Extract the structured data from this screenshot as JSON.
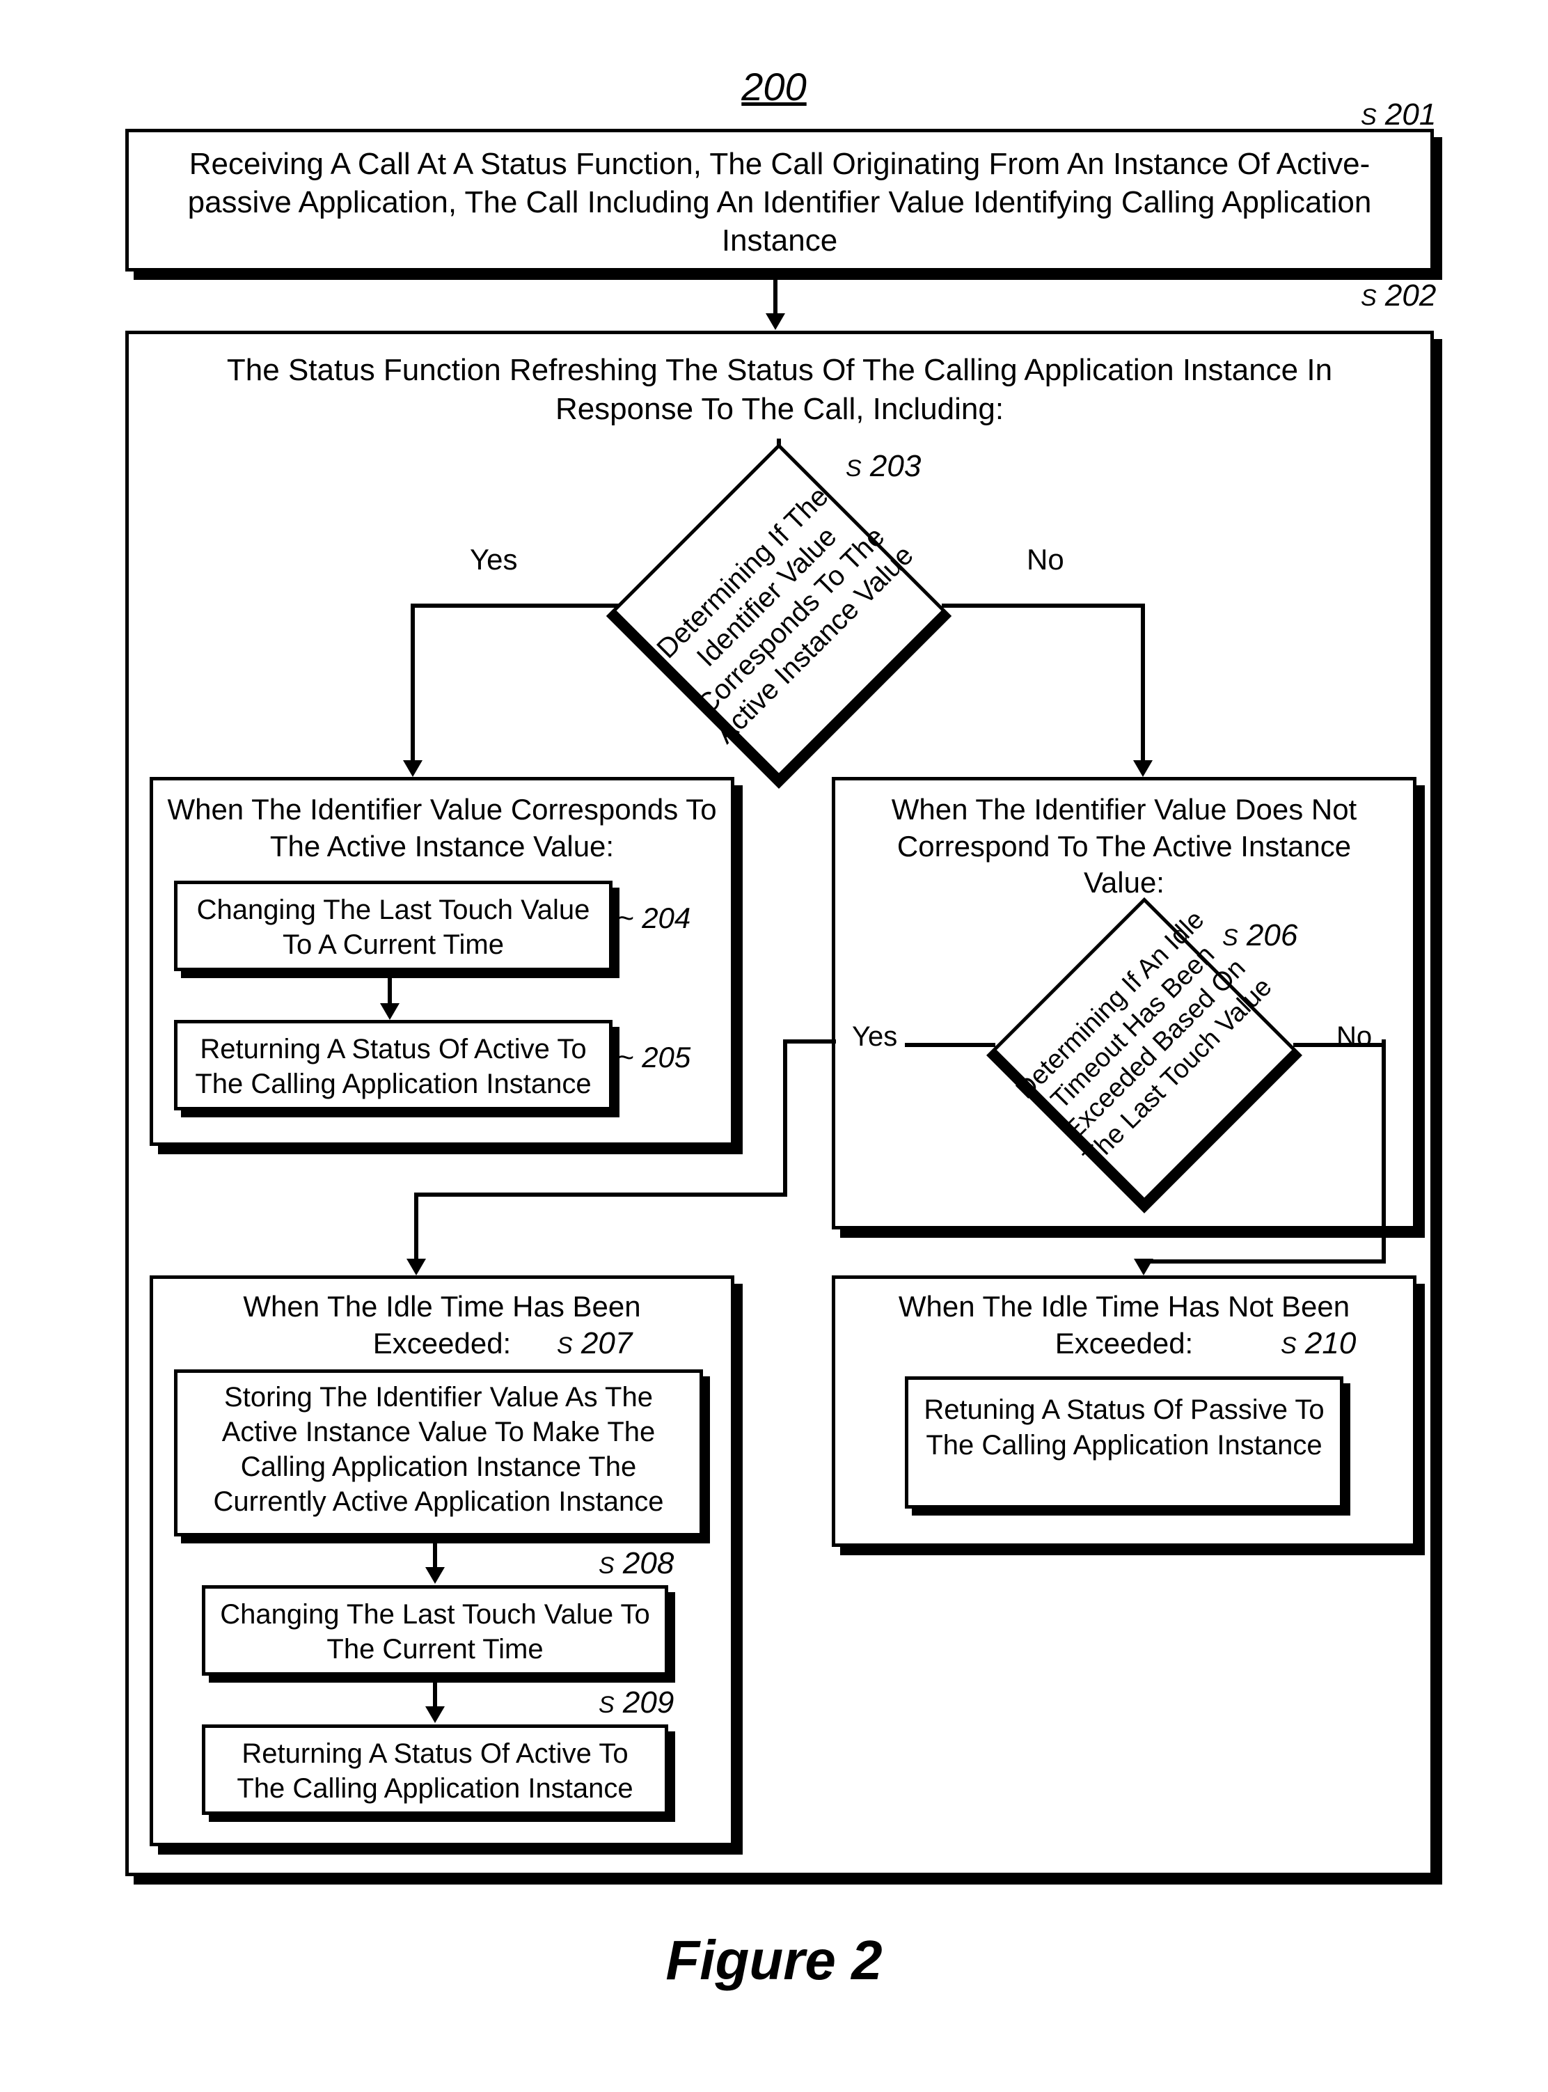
{
  "figure": {
    "number": "200",
    "caption": "Figure 2"
  },
  "refs": {
    "b201": "201",
    "b202": "202",
    "b203": "203",
    "b204": "204",
    "b205": "205",
    "b206": "206",
    "b207": "207",
    "b208": "208",
    "b209": "209",
    "b210": "210"
  },
  "labels": {
    "yes": "Yes",
    "no": "No"
  },
  "blocks": {
    "b201": "Receiving A Call At A Status Function, The Call Originating From An Instance Of Active-passive Application, The Call Including An Identifier Value Identifying Calling Application Instance",
    "b202_header": "The Status Function Refreshing The Status Of The Calling Application Instance In Response To The Call, Including:",
    "d203": "Determining If The Identifier Value Corresponds To The Active Instance Value",
    "yes_branch_header": "When The Identifier Value Corresponds To The Active Instance Value:",
    "b204": "Changing The Last Touch Value To A Current Time",
    "b205": "Returning A Status Of Active To The Calling Application Instance",
    "no_branch_header": "When The Identifier Value Does Not Correspond To The Active Instance Value:",
    "d206": "Determining If An Idle Timeout Has Been Exceeded Based On The Last Touch Value",
    "idle_exceeded_header": "When The Idle Time Has Been Exceeded:",
    "b207": "Storing The Identifier Value As The Active Instance Value To Make The Calling Application Instance The Currently Active Application Instance",
    "b208": "Changing The Last Touch Value To The Current Time",
    "b209": "Returning A Status Of Active To The Calling Application Instance",
    "idle_not_header": "When The Idle Time Has Not Been Exceeded:",
    "b210": "Retuning A Status Of Passive To The Calling Application Instance"
  }
}
